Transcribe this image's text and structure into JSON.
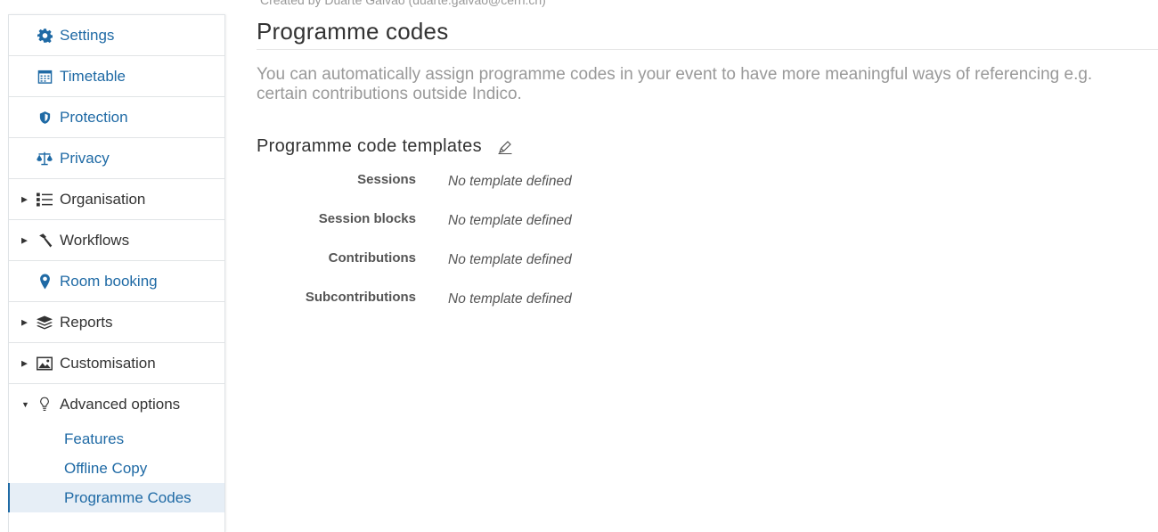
{
  "header": {
    "created_by": "Created by Duarte Galvão (duarte.galvao@cern.ch)"
  },
  "sidebar": {
    "items": [
      {
        "label": "Settings",
        "icon": "gear-icon"
      },
      {
        "label": "Timetable",
        "icon": "calendar-icon"
      },
      {
        "label": "Protection",
        "icon": "shield-icon"
      },
      {
        "label": "Privacy",
        "icon": "scales-icon"
      },
      {
        "label": "Organisation",
        "icon": "list-icon"
      },
      {
        "label": "Workflows",
        "icon": "hammer-icon"
      },
      {
        "label": "Room booking",
        "icon": "map-pin-icon"
      },
      {
        "label": "Reports",
        "icon": "layers-icon"
      },
      {
        "label": "Customisation",
        "icon": "image-icon"
      },
      {
        "label": "Advanced options",
        "icon": "lightbulb-icon"
      }
    ],
    "sub_items": [
      {
        "label": "Features"
      },
      {
        "label": "Offline Copy"
      },
      {
        "label": "Programme Codes"
      }
    ]
  },
  "main": {
    "title": "Programme codes",
    "intro": "You can automatically assign programme codes in your event to have more meaningful ways of referencing e.g. certain contributions outside Indico.",
    "section_title": "Programme code templates",
    "templates": [
      {
        "key": "Sessions",
        "value": "No template defined"
      },
      {
        "key": "Session blocks",
        "value": "No template defined"
      },
      {
        "key": "Contributions",
        "value": "No template defined"
      },
      {
        "key": "Subcontributions",
        "value": "No template defined"
      }
    ]
  },
  "colors": {
    "link": "#1f6aa5",
    "text": "#333333",
    "muted": "#999999",
    "active_bg": "#e6eef6"
  }
}
